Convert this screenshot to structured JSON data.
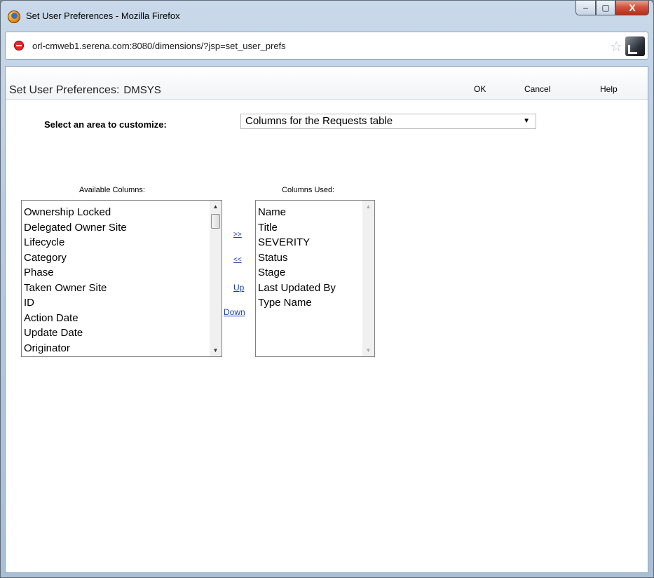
{
  "window": {
    "title": "Set User Preferences - Mozilla Firefox",
    "controls": {
      "minimize": "–",
      "maximize": "▢",
      "close": "X"
    }
  },
  "browser": {
    "url": "orl-cmweb1.serena.com:8080/dimensions/?jsp=set_user_prefs"
  },
  "header": {
    "title": "Set User Preferences:",
    "user": "DMSYS",
    "ok_label": "OK",
    "cancel_label": "Cancel",
    "help_label": "Help"
  },
  "area": {
    "label": "Select an area to customize:",
    "selected": "Columns for the Requests table"
  },
  "available": {
    "header": "Available Columns:",
    "items": [
      "Ownership Locked",
      "Delegated Owner Site",
      "Lifecycle",
      "Category",
      "Phase",
      "Taken Owner Site",
      "ID",
      "Action Date",
      "Update Date",
      "Originator"
    ]
  },
  "used": {
    "header": "Columns Used:",
    "items": [
      "Name",
      "Title",
      "SEVERITY",
      "Status",
      "Stage",
      "Last Updated By",
      "Type Name"
    ]
  },
  "actions": {
    "add": ">>",
    "remove": "<<",
    "up": "Up",
    "down": "Down"
  }
}
